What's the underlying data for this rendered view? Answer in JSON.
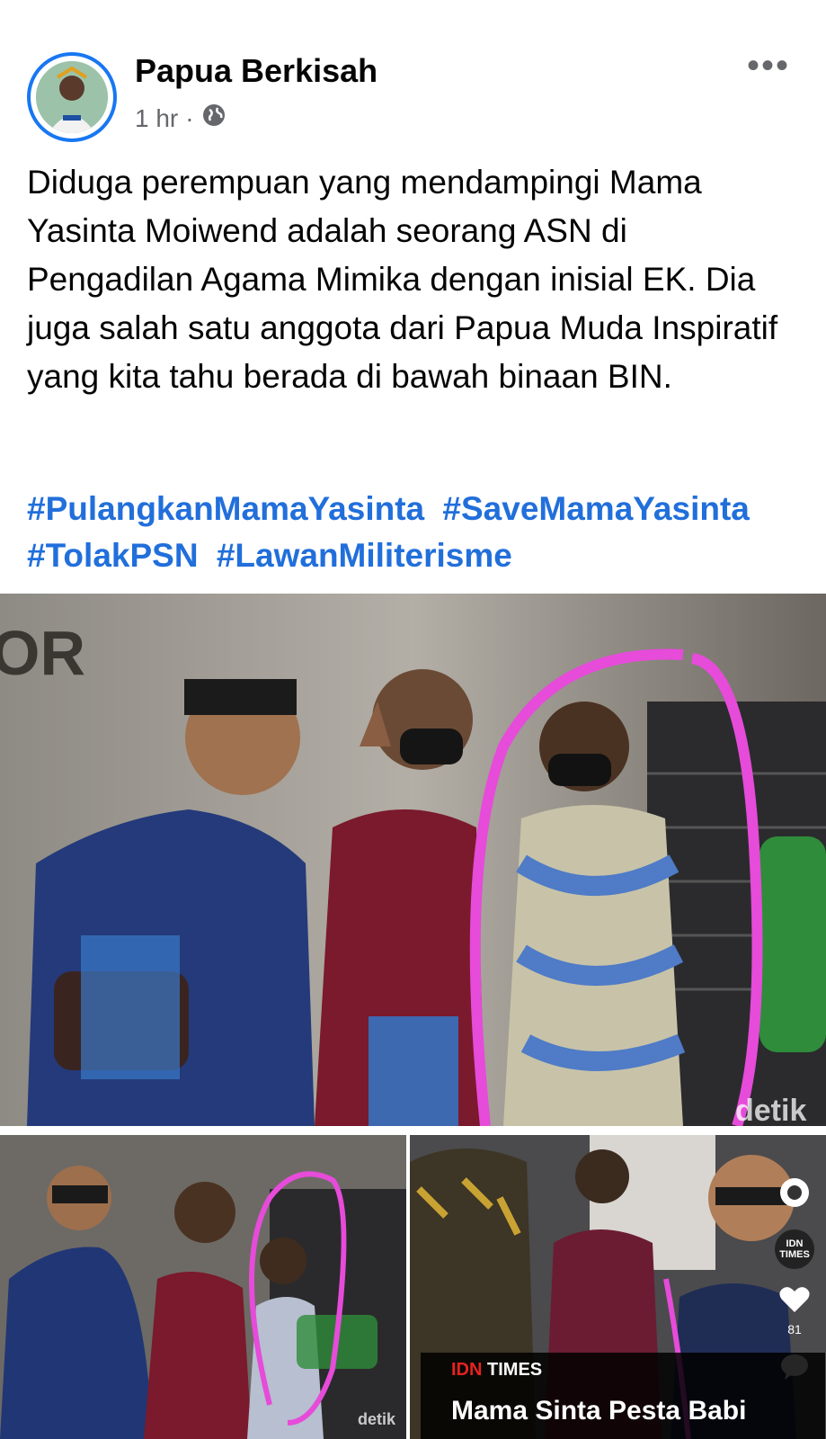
{
  "post": {
    "author": "Papua Berkisah",
    "time": "1 hr",
    "separator": "·",
    "privacy_icon": "globe-icon",
    "text": "Diduga perempuan yang mendampingi Mama Yasinta Moiwend adalah seorang ASN di Pengadilan Agama Mimika dengan inisial EK. Dia juga salah satu anggota dari Papua Muda Inspiratif yang kita tahu berada di bawah binaan BIN.",
    "hashtags": [
      "#PulangkanMamaYasinta",
      "#SaveMamaYasinta",
      "#TolakPSN",
      "#LawanMiliterisme"
    ]
  },
  "photos": {
    "main": {
      "wall_text": "OR",
      "watermark": "detik"
    },
    "bottom_left": {
      "watermark": "detik"
    },
    "bottom_right": {
      "side_label": "IDN TIMES",
      "like_count": "81",
      "caption_brand_a": "IDN",
      "caption_brand_b": " TIMES",
      "caption_title": "Mama Sinta Pesta Babi"
    }
  },
  "colors": {
    "accent_blue": "#1877f2",
    "hashtag_blue": "#216fdb",
    "highlight_circle": "#e64bd9"
  }
}
